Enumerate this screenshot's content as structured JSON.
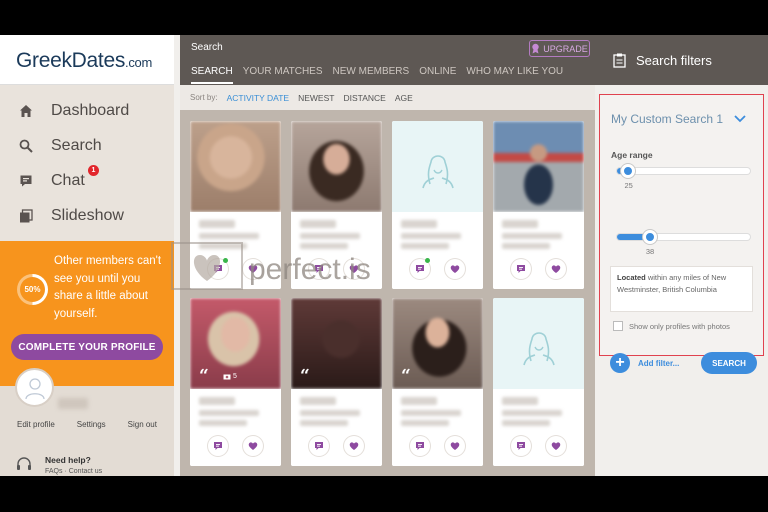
{
  "brand": {
    "name": "GreekDates",
    "domain": ".com"
  },
  "nav": [
    {
      "label": "Dashboard",
      "icon": "home-icon"
    },
    {
      "label": "Search",
      "icon": "search-icon"
    },
    {
      "label": "Chat",
      "icon": "chat-icon",
      "badge": "1"
    },
    {
      "label": "Slideshow",
      "icon": "slideshow-icon"
    }
  ],
  "promo": {
    "percent": "50%",
    "progress_fraction": 0.5,
    "text": "Other members can't see you until you share a little about yourself.",
    "button": "COMPLETE YOUR PROFILE"
  },
  "user_links": [
    "Edit profile",
    "Settings",
    "Sign out"
  ],
  "help": {
    "title": "Need help?",
    "links": "FAQs · Contact us"
  },
  "main": {
    "title": "Search",
    "upgrade": "UPGRADE",
    "tabs": [
      "SEARCH",
      "YOUR MATCHES",
      "NEW MEMBERS",
      "ONLINE",
      "WHO MAY LIKE YOU"
    ],
    "active_tab": 0,
    "sort_label": "Sort by:",
    "sort_options": [
      "ACTIVITY DATE",
      "NEWEST",
      "DISTANCE",
      "AGE"
    ],
    "active_sort": 0
  },
  "cards": [
    {
      "photo": "blurred",
      "online": true
    },
    {
      "photo": "blurred",
      "online": false
    },
    {
      "photo": "placeholder",
      "online": true
    },
    {
      "photo": "blurred",
      "online": false
    },
    {
      "photo": "blurred",
      "online": false,
      "quote": "“",
      "photo_count": "5"
    },
    {
      "photo": "blurred",
      "online": false,
      "quote": "“"
    },
    {
      "photo": "blurred",
      "online": false,
      "quote": "“"
    },
    {
      "photo": "placeholder",
      "online": false
    }
  ],
  "watermark": "perfect.is",
  "filters": {
    "header": "Search filters",
    "search_name": "My Custom Search 1",
    "age_label": "Age range",
    "age_min": "25",
    "age_max": "38",
    "age_min_value": 25,
    "age_max_value": 38,
    "age_scale_min": 18,
    "age_scale_max": 99,
    "location_bold": "Located",
    "location_rest": " within any miles of New Westminster, British Columbia",
    "photos_only": "Show only profiles with photos",
    "photos_only_checked": false,
    "add_filter": "Add filter...",
    "search_button": "SEARCH"
  },
  "colors": {
    "accent": "#3d8ddd",
    "promo": "#f7941d",
    "purple": "#8e4aa0",
    "highlight": "#e0424f"
  }
}
